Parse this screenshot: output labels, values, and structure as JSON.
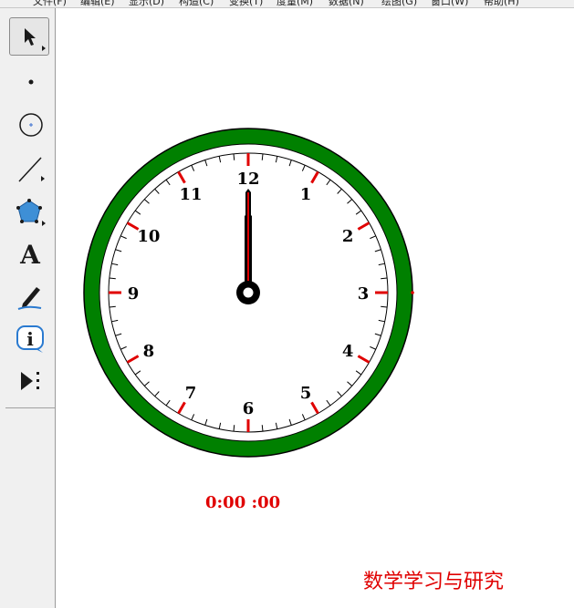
{
  "menu": {
    "items": [
      "文件(F)",
      "编辑(E)",
      "显示(D)",
      "构造(C)",
      "变换(T)",
      "度量(M)",
      "数据(N)",
      "绘图(G)",
      "窗口(W)",
      "帮助(H)"
    ]
  },
  "toolbox": {
    "tools": [
      {
        "name": "arrow-tool",
        "icon": "arrow-icon",
        "selected": true
      },
      {
        "name": "point-tool",
        "icon": "point-icon"
      },
      {
        "name": "compass-tool",
        "icon": "circle-icon"
      },
      {
        "name": "straightedge-tool",
        "icon": "line-icon"
      },
      {
        "name": "polygon-tool",
        "icon": "polygon-icon"
      },
      {
        "name": "text-tool",
        "icon": "text-icon",
        "label": "A"
      },
      {
        "name": "marker-tool",
        "icon": "marker-icon"
      },
      {
        "name": "information-tool",
        "icon": "info-icon",
        "label": "i"
      },
      {
        "name": "custom-tool",
        "icon": "custom-tool-icon"
      }
    ]
  },
  "clock": {
    "numbers": [
      "12",
      "1",
      "2",
      "3",
      "4",
      "5",
      "6",
      "7",
      "8",
      "9",
      "10",
      "11"
    ],
    "hour": 0,
    "minute": 0,
    "second": 0,
    "colors": {
      "rim": "#008000",
      "hour_tick": "#e00000",
      "minute_tick": "#000000",
      "hand_fill": "#000000",
      "hand_line": "#e00000"
    }
  },
  "time_readout": "0:00 :00",
  "watermark": "数学学习与研究"
}
